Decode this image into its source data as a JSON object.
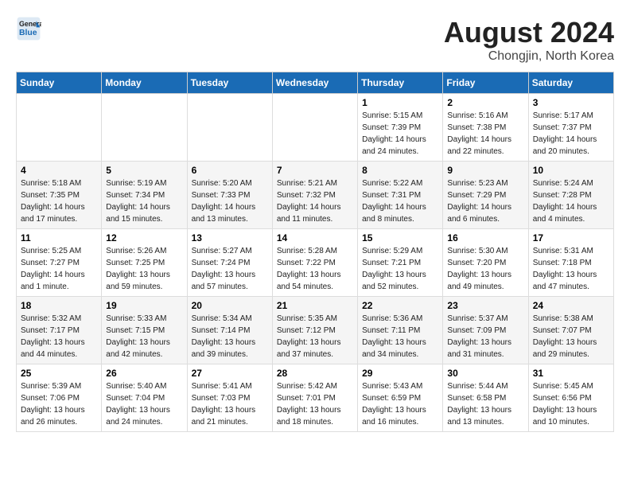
{
  "header": {
    "logo_line1": "General",
    "logo_line2": "Blue",
    "title": "August 2024",
    "subtitle": "Chongjin, North Korea"
  },
  "weekdays": [
    "Sunday",
    "Monday",
    "Tuesday",
    "Wednesday",
    "Thursday",
    "Friday",
    "Saturday"
  ],
  "weeks": [
    [
      {
        "day": "",
        "info": ""
      },
      {
        "day": "",
        "info": ""
      },
      {
        "day": "",
        "info": ""
      },
      {
        "day": "",
        "info": ""
      },
      {
        "day": "1",
        "info": "Sunrise: 5:15 AM\nSunset: 7:39 PM\nDaylight: 14 hours\nand 24 minutes."
      },
      {
        "day": "2",
        "info": "Sunrise: 5:16 AM\nSunset: 7:38 PM\nDaylight: 14 hours\nand 22 minutes."
      },
      {
        "day": "3",
        "info": "Sunrise: 5:17 AM\nSunset: 7:37 PM\nDaylight: 14 hours\nand 20 minutes."
      }
    ],
    [
      {
        "day": "4",
        "info": "Sunrise: 5:18 AM\nSunset: 7:35 PM\nDaylight: 14 hours\nand 17 minutes."
      },
      {
        "day": "5",
        "info": "Sunrise: 5:19 AM\nSunset: 7:34 PM\nDaylight: 14 hours\nand 15 minutes."
      },
      {
        "day": "6",
        "info": "Sunrise: 5:20 AM\nSunset: 7:33 PM\nDaylight: 14 hours\nand 13 minutes."
      },
      {
        "day": "7",
        "info": "Sunrise: 5:21 AM\nSunset: 7:32 PM\nDaylight: 14 hours\nand 11 minutes."
      },
      {
        "day": "8",
        "info": "Sunrise: 5:22 AM\nSunset: 7:31 PM\nDaylight: 14 hours\nand 8 minutes."
      },
      {
        "day": "9",
        "info": "Sunrise: 5:23 AM\nSunset: 7:29 PM\nDaylight: 14 hours\nand 6 minutes."
      },
      {
        "day": "10",
        "info": "Sunrise: 5:24 AM\nSunset: 7:28 PM\nDaylight: 14 hours\nand 4 minutes."
      }
    ],
    [
      {
        "day": "11",
        "info": "Sunrise: 5:25 AM\nSunset: 7:27 PM\nDaylight: 14 hours\nand 1 minute."
      },
      {
        "day": "12",
        "info": "Sunrise: 5:26 AM\nSunset: 7:25 PM\nDaylight: 13 hours\nand 59 minutes."
      },
      {
        "day": "13",
        "info": "Sunrise: 5:27 AM\nSunset: 7:24 PM\nDaylight: 13 hours\nand 57 minutes."
      },
      {
        "day": "14",
        "info": "Sunrise: 5:28 AM\nSunset: 7:22 PM\nDaylight: 13 hours\nand 54 minutes."
      },
      {
        "day": "15",
        "info": "Sunrise: 5:29 AM\nSunset: 7:21 PM\nDaylight: 13 hours\nand 52 minutes."
      },
      {
        "day": "16",
        "info": "Sunrise: 5:30 AM\nSunset: 7:20 PM\nDaylight: 13 hours\nand 49 minutes."
      },
      {
        "day": "17",
        "info": "Sunrise: 5:31 AM\nSunset: 7:18 PM\nDaylight: 13 hours\nand 47 minutes."
      }
    ],
    [
      {
        "day": "18",
        "info": "Sunrise: 5:32 AM\nSunset: 7:17 PM\nDaylight: 13 hours\nand 44 minutes."
      },
      {
        "day": "19",
        "info": "Sunrise: 5:33 AM\nSunset: 7:15 PM\nDaylight: 13 hours\nand 42 minutes."
      },
      {
        "day": "20",
        "info": "Sunrise: 5:34 AM\nSunset: 7:14 PM\nDaylight: 13 hours\nand 39 minutes."
      },
      {
        "day": "21",
        "info": "Sunrise: 5:35 AM\nSunset: 7:12 PM\nDaylight: 13 hours\nand 37 minutes."
      },
      {
        "day": "22",
        "info": "Sunrise: 5:36 AM\nSunset: 7:11 PM\nDaylight: 13 hours\nand 34 minutes."
      },
      {
        "day": "23",
        "info": "Sunrise: 5:37 AM\nSunset: 7:09 PM\nDaylight: 13 hours\nand 31 minutes."
      },
      {
        "day": "24",
        "info": "Sunrise: 5:38 AM\nSunset: 7:07 PM\nDaylight: 13 hours\nand 29 minutes."
      }
    ],
    [
      {
        "day": "25",
        "info": "Sunrise: 5:39 AM\nSunset: 7:06 PM\nDaylight: 13 hours\nand 26 minutes."
      },
      {
        "day": "26",
        "info": "Sunrise: 5:40 AM\nSunset: 7:04 PM\nDaylight: 13 hours\nand 24 minutes."
      },
      {
        "day": "27",
        "info": "Sunrise: 5:41 AM\nSunset: 7:03 PM\nDaylight: 13 hours\nand 21 minutes."
      },
      {
        "day": "28",
        "info": "Sunrise: 5:42 AM\nSunset: 7:01 PM\nDaylight: 13 hours\nand 18 minutes."
      },
      {
        "day": "29",
        "info": "Sunrise: 5:43 AM\nSunset: 6:59 PM\nDaylight: 13 hours\nand 16 minutes."
      },
      {
        "day": "30",
        "info": "Sunrise: 5:44 AM\nSunset: 6:58 PM\nDaylight: 13 hours\nand 13 minutes."
      },
      {
        "day": "31",
        "info": "Sunrise: 5:45 AM\nSunset: 6:56 PM\nDaylight: 13 hours\nand 10 minutes."
      }
    ]
  ]
}
